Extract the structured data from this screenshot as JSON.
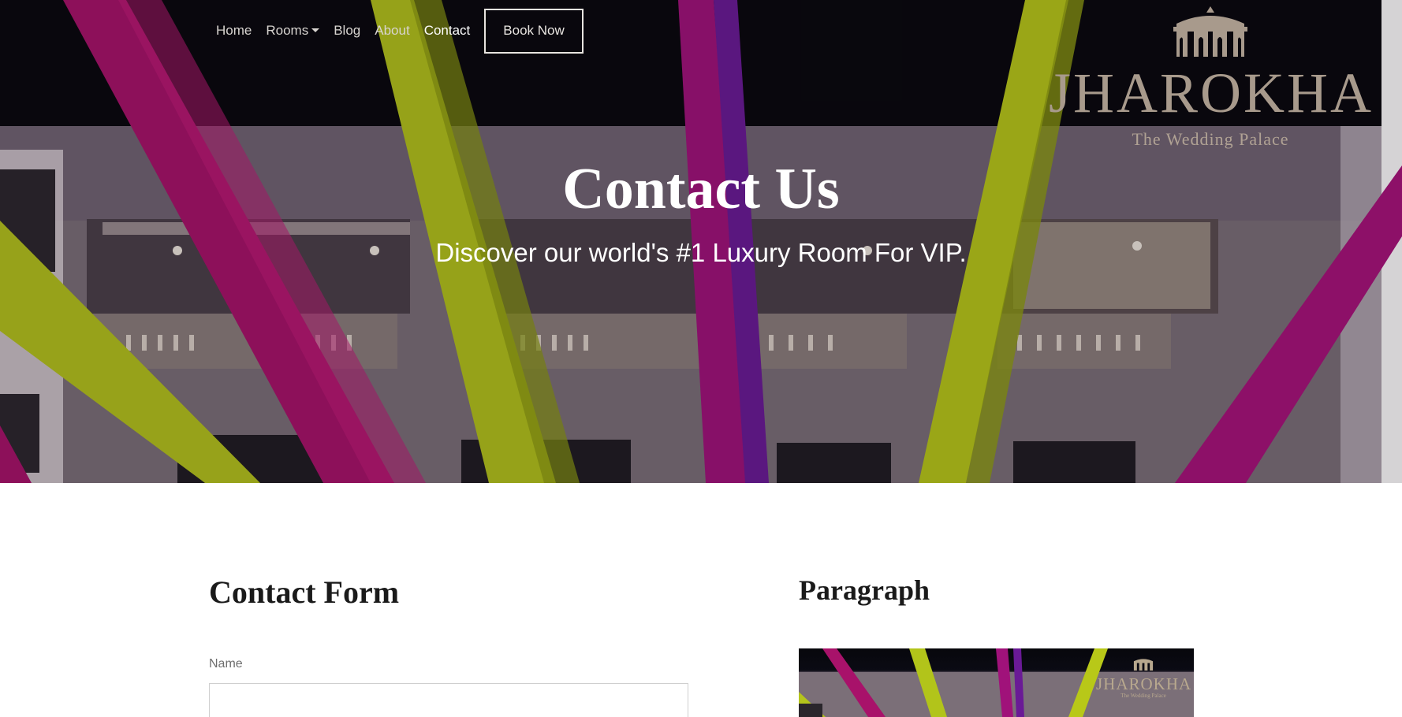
{
  "nav": {
    "items": [
      {
        "label": "Home"
      },
      {
        "label": "Rooms",
        "has_dropdown": true
      },
      {
        "label": "Blog"
      },
      {
        "label": "About"
      },
      {
        "label": "Contact",
        "active": true
      }
    ],
    "book_label": "Book Now"
  },
  "logo": {
    "word": "JHAROKHA",
    "tagline": "The Wedding Palace"
  },
  "hero": {
    "title": "Contact Us",
    "subtitle": "Discover our world's #1 Luxury Room For VIP."
  },
  "contact_form": {
    "title": "Contact Form",
    "name_label": "Name",
    "name_value": ""
  },
  "paragraph": {
    "title": "Paragraph"
  },
  "colors": {
    "hero_overlay": "#0a0a12",
    "magenta_drape": "#b0126e",
    "lime_drape": "#b8c818",
    "purple_drape": "#7a1aa0",
    "logo_gold": "#a89a8c"
  },
  "icons": [
    "logo-mark-icon",
    "dropdown-caret-icon"
  ]
}
